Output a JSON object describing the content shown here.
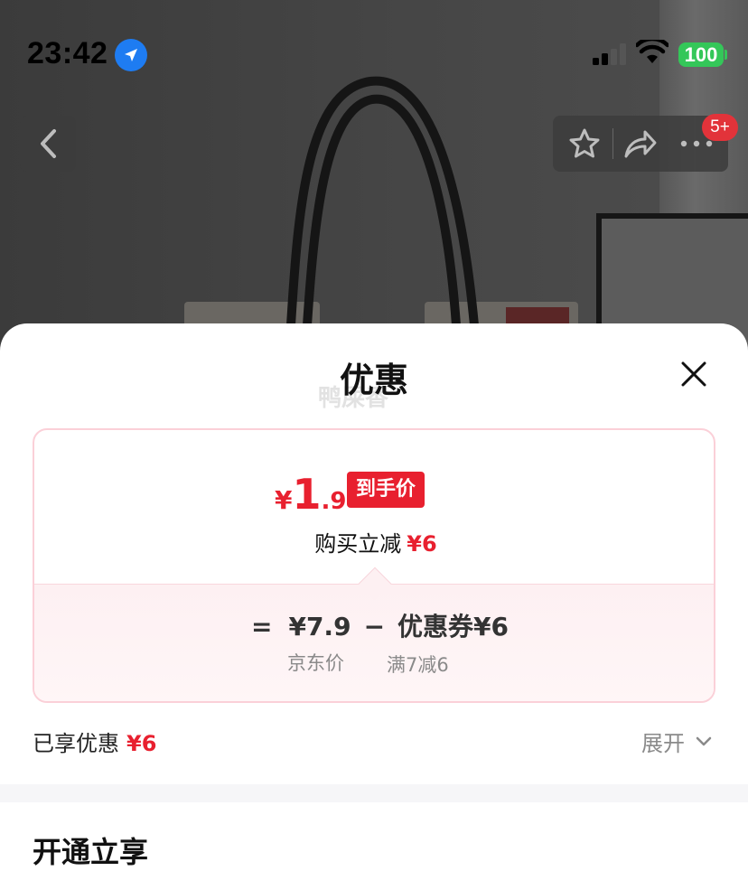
{
  "status_bar": {
    "time": "23:42",
    "battery": "100"
  },
  "header": {
    "message_badge": "5+"
  },
  "sheet": {
    "title": "优惠",
    "watermark": "鸭屎香",
    "price_card": {
      "final_price_symbol": "¥",
      "final_price_integer": "1",
      "final_price_decimal": ".9",
      "final_price_tag": "到手价",
      "instant_cut_label": "购买立减",
      "instant_cut_amount": "¥6",
      "equals": "=",
      "jd_price": "¥7.9",
      "minus": "−",
      "coupon": "优惠券¥6",
      "jd_price_label": "京东价",
      "coupon_condition": "满7减6"
    },
    "enjoyed_label": "已享优惠",
    "enjoyed_amount": "¥6",
    "expand_label": "展开",
    "next_section_title": "开通立享"
  },
  "colors": {
    "accent_red": "#e8202f",
    "card_border": "#fbd0d8",
    "location_blue": "#1e7cf2",
    "battery_green": "#34c759"
  }
}
